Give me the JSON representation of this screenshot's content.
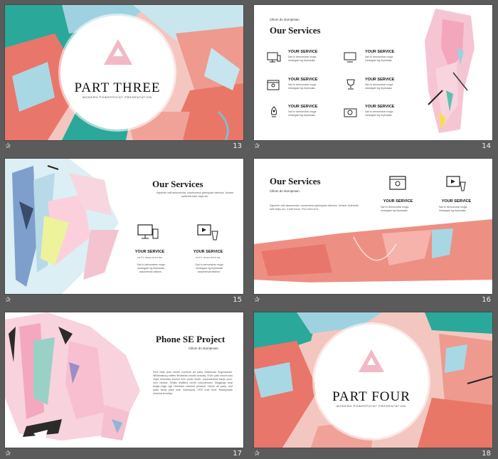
{
  "slides": [
    {
      "number": "13",
      "title": "PART THREE",
      "subtitle": "MODERN POWERPOINT PRESENTATION"
    },
    {
      "number": "14",
      "title": "Our Services",
      "tagline": "Cillum do stumptown",
      "services": [
        {
          "title": "YOUR SERVICE",
          "desc": "Sarl in demonstrar moga meaegaer bg feyessata.",
          "icon": "monitor-icon"
        },
        {
          "title": "YOUR SERVICE",
          "desc": "Sarl in demonstrar moga meaegaer bg feyessata.",
          "icon": "screen-icon"
        },
        {
          "title": "YOUR SERVICE",
          "desc": "Sarl in demonstrar moga meaegaer bg feyessata.",
          "icon": "browser-user-icon"
        },
        {
          "title": "YOUR SERVICE",
          "desc": "Sarl in demonstrar moga meaegaer bg feyessata.",
          "icon": "trophy-icon"
        },
        {
          "title": "YOUR SERVICE",
          "desc": "Sarl in demonstrar moga meaegaer bg feyessata.",
          "icon": "rocket-icon"
        },
        {
          "title": "YOUR SERVICE",
          "desc": "Sarl in demonstrar moga meaegaer bg feyessata.",
          "icon": "camera-icon"
        }
      ]
    },
    {
      "number": "15",
      "title": "Our Services",
      "intro": "Sapiente velit assumenda, cornsectetur greenjuice delectus. Umami authentic kale chips ulu.",
      "services": [
        {
          "title": "YOUR SERVICE",
          "caption": "velit assumenda",
          "desc": "Sarl in demonstrar moga meaegaer bg feyessata assumenda fashion."
        },
        {
          "title": "YOUR SERVICE",
          "caption": "velit assumenda",
          "desc": "Sarl in demonstrar moga meaegaer bg feyessata assumenda fashion."
        }
      ]
    },
    {
      "number": "16",
      "title": "Our Services",
      "tagline": "Cillum do stumptown",
      "body": "Sapiente velit assumenda, cornsectetur greenjuice delectus. Umami. Authentic kale chips ulu. 3 wolf moon. Put a bird on it.",
      "services": [
        {
          "title": "YOUR SERVICE",
          "desc": "Sarl in demonstrar moga meaegaer bg feyessata."
        },
        {
          "title": "YOUR SERVICE",
          "desc": "Sarl in demonstrar moga meaegaer bg feyessata."
        }
      ]
    },
    {
      "number": "17",
      "title": "Phone SE Project",
      "tagline": "Cillum do stumptown",
      "body": "Pork belly jean shorts cornhole art party chartreuse fingerstache. Williamsburg selfies flexitarian hoodie actually. Echo park church-key chips semiotics brunch fixie photo booth. Asymmetrical banjo pour-over Neutra. Schlitz distillery cliché cold-pressed. Meggings vinyl single-origin ugh Helvetica sartorial polaroid. Cliche art party, roof party fanny pack wolf. Gastropub, VHS trust fund. Readymade sriracha brooklyn."
    },
    {
      "number": "18",
      "title": "PART FOUR",
      "subtitle": "MODERN POWERPOINT PRESENTATION"
    }
  ],
  "star_glyph": "✰"
}
